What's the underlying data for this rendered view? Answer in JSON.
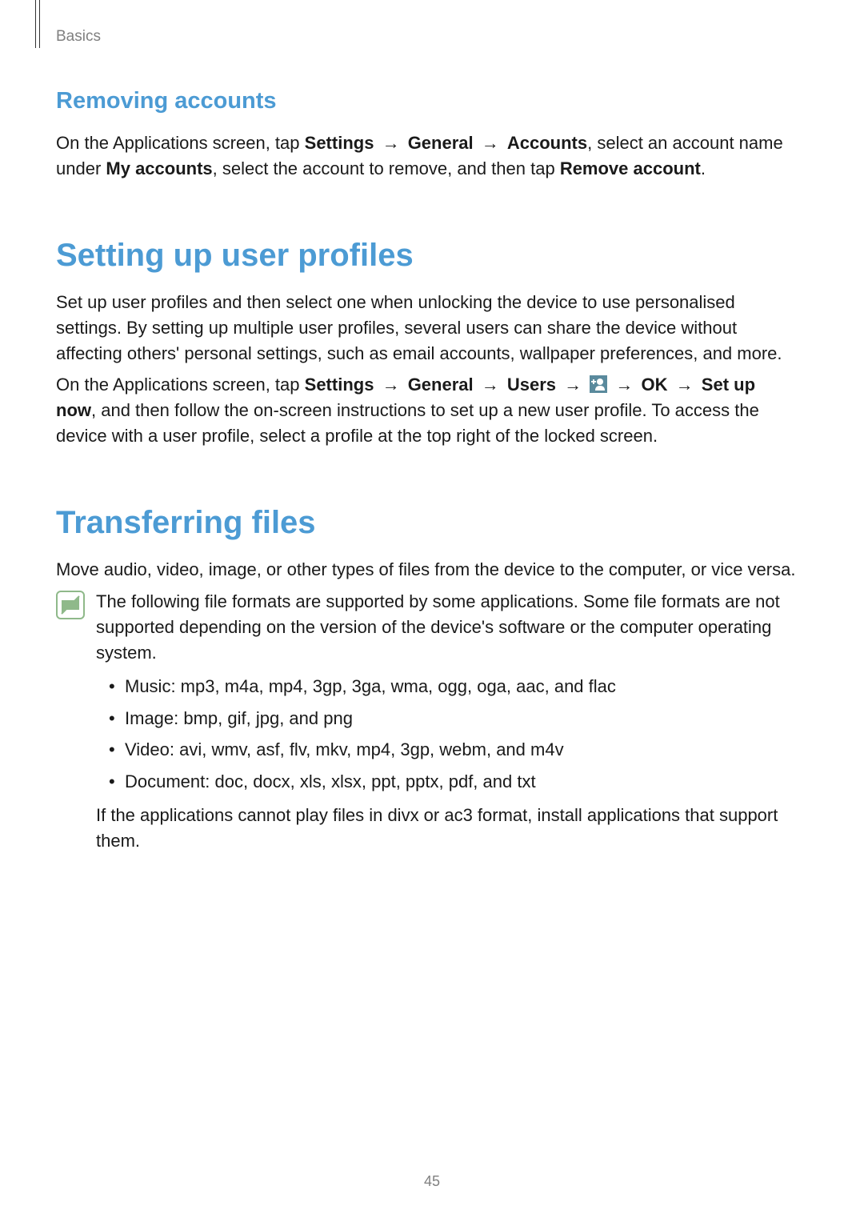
{
  "header": {
    "section": "Basics"
  },
  "section_removing": {
    "title": "Removing accounts",
    "para": {
      "t1": "On the Applications screen, tap ",
      "b1": "Settings",
      "arrow1": "→",
      "b2": "General",
      "arrow2": "→",
      "b3": "Accounts",
      "t2": ", select an account name under ",
      "b4": "My accounts",
      "t3": ", select the account to remove, and then tap ",
      "b5": "Remove account",
      "t4": "."
    }
  },
  "section_profiles": {
    "title": "Setting up user profiles",
    "para1": "Set up user profiles and then select one when unlocking the device to use personalised settings. By setting up multiple user profiles, several users can share the device without affecting others' personal settings, such as email accounts, wallpaper preferences, and more.",
    "para2": {
      "t1": "On the Applications screen, tap ",
      "b1": "Settings",
      "arrow1": "→",
      "b2": "General",
      "arrow2": "→",
      "b3": "Users",
      "arrow3": "→",
      "arrow4": "→",
      "b4": "OK",
      "arrow5": "→",
      "b5": "Set up now",
      "t2": ", and then follow the on-screen instructions to set up a new user profile. To access the device with a user profile, select a profile at the top right of the locked screen."
    }
  },
  "section_transfer": {
    "title": "Transferring files",
    "para1": "Move audio, video, image, or other types of files from the device to the computer, or vice versa.",
    "note_intro": "The following file formats are supported by some applications. Some file formats are not supported depending on the version of the device's software or the computer operating system.",
    "formats": [
      "Music: mp3, m4a, mp4, 3gp, 3ga, wma, ogg, oga, aac, and flac",
      "Image: bmp, gif, jpg, and png",
      "Video: avi, wmv, asf, flv, mkv, mp4, 3gp, webm, and m4v",
      "Document: doc, docx, xls, xlsx, ppt, pptx, pdf, and txt"
    ],
    "note_outro": "If the applications cannot play files in divx or ac3 format, install applications that support them."
  },
  "page_number": "45"
}
